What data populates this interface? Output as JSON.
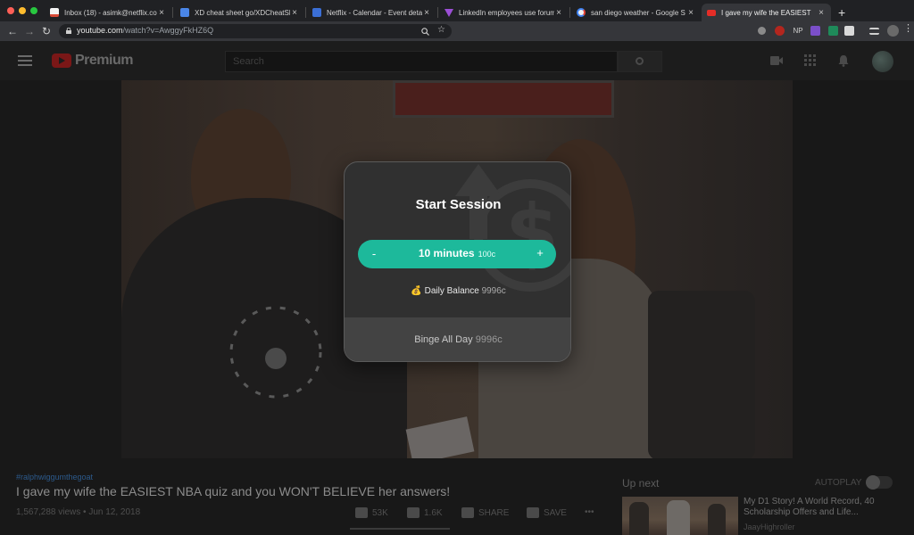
{
  "browser": {
    "tabs": [
      {
        "title": "Inbox (18) - asimk@netflix.com",
        "favicon_color": "#d84a38",
        "active": false
      },
      {
        "title": "XD cheat sheet go/XDCheatSh",
        "favicon_color": "#4a86e8",
        "active": false
      },
      {
        "title": "Netflix - Calendar - Event deta",
        "favicon_color": "#3b6fd6",
        "active": false
      },
      {
        "title": "LinkedIn employees use forum",
        "favicon_color": "#9c4fd6",
        "active": false
      },
      {
        "title": "san diego weather - Google S",
        "favicon_color": "#f2f2f2",
        "active": false
      },
      {
        "title": "I gave my wife the EASIEST",
        "favicon_color": "#e52d27",
        "active": true
      }
    ],
    "new_tab_label": "+",
    "close_label": "×",
    "url_host": "youtube.com",
    "url_path": "/watch?v=AwggyFkHZ6Q",
    "nav": {
      "back": "←",
      "forward": "→",
      "reload": "↻"
    },
    "ext_np_label": "NP"
  },
  "youtube": {
    "brand": "Premium",
    "search_placeholder": "Search",
    "hashtag": "#ralphwiggumthegoat",
    "video_title": "I gave my wife the EASIEST NBA quiz and you WON'T BELIEVE her answers!",
    "views_date": "1,567,288 views • Jun 12, 2018",
    "likes": "53K",
    "dislikes": "1.6K",
    "share_label": "SHARE",
    "save_label": "SAVE",
    "more_label": "•••",
    "up_next_label": "Up next",
    "autoplay_label": "AUTOPLAY",
    "recommendation": {
      "title": "My D1 Story! A World Record, 40 Scholarship Offers and Life...",
      "channel": "JaayHighroller"
    }
  },
  "modal": {
    "title": "Start Session",
    "minus_label": "-",
    "plus_label": "+",
    "duration": "10 minutes",
    "cost": "100c",
    "balance_icon": "💰",
    "balance_label": "Daily Balance",
    "balance_value": "9996c",
    "binge_label": "Binge All Day",
    "binge_value": "9996c",
    "accent_color": "#1db99b"
  }
}
